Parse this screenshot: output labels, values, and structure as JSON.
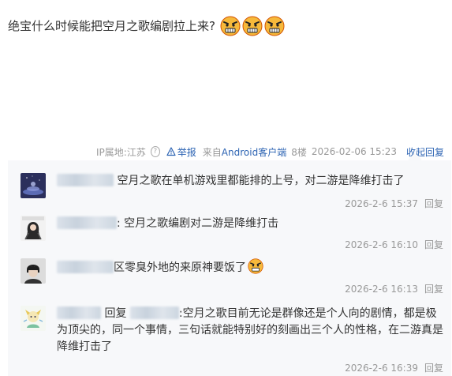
{
  "post": {
    "text": "绝宝什么时候能把空月之歌编剧拉上来?",
    "emoji_icon": "angry-face-icon",
    "emoji_count": 3
  },
  "meta": {
    "ip": "IP属地:江苏",
    "report": "举报",
    "source_prefix": "来自",
    "source_app": "Android客户端",
    "floor": "8楼",
    "datetime": "2026-02-06 15:23",
    "collapse": "收起回复"
  },
  "comments": [
    {
      "text": "空月之歌在单机游戏里都能排的上号，对二游是降维打击了",
      "time": "2026-2-6 15:37",
      "reply": "回复"
    },
    {
      "text": ": 空月之歌编剧对二游是降维打击",
      "time": "2026-2-6 16:10",
      "reply": "回复"
    },
    {
      "text": "区零臭外地的来原神要饭了",
      "time": "2026-2-6 16:13",
      "reply": "回复"
    },
    {
      "reply_prefix": "回复",
      "text": ":空月之歌目前无论是群像还是个人向的剧情，都是极为顶尖的，同一个事情，三句话就能特别好的刻画出三个人的性格，在二游真是降维打击了",
      "time": "2026-2-6 16:39",
      "reply": "回复"
    }
  ],
  "colors": {
    "link": "#2d64b3",
    "meta_gray": "#999999",
    "reply_bg": "#f7f8fa",
    "emoji_yellow": "#f6b93b",
    "emoji_red": "#e74c3c"
  }
}
